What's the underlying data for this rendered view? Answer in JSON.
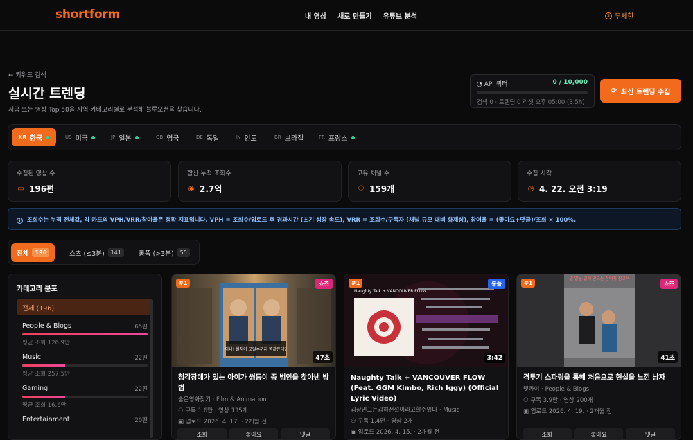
{
  "header": {
    "logo": "shortform",
    "nav": [
      "내 영상",
      "새로 만들기",
      "유튜브 분석"
    ],
    "plan": "무제한"
  },
  "page": {
    "back_link": "← 키워드 검색",
    "title": "실시간 트렌딩",
    "subtitle": "지금 뜨는 영상 Top 50을 지역·카테고리별로 분석해 블루오션을 찾습니다."
  },
  "quota": {
    "label": "API 쿼터",
    "value": "0 / 10,000",
    "meta": "검색 0 · 트렌딩 0 리셋 오후 05:00 (3.5h)",
    "progress": 0
  },
  "refresh_button": "최신 트렌딩 수집",
  "regions": [
    {
      "code": "KR",
      "name": "한국",
      "dot": true,
      "active": true
    },
    {
      "code": "US",
      "name": "미국",
      "dot": true,
      "active": false
    },
    {
      "code": "JP",
      "name": "일본",
      "dot": true,
      "active": false
    },
    {
      "code": "GB",
      "name": "영국",
      "dot": false,
      "active": false
    },
    {
      "code": "DE",
      "name": "독일",
      "dot": false,
      "active": false
    },
    {
      "code": "IN",
      "name": "인도",
      "dot": false,
      "active": false
    },
    {
      "code": "BR",
      "name": "브라질",
      "dot": false,
      "active": false
    },
    {
      "code": "FR",
      "name": "프랑스",
      "dot": true,
      "active": false
    }
  ],
  "stats": [
    {
      "label": "수집된 영상 수",
      "value": "196편",
      "icon": "video-icon"
    },
    {
      "label": "합산 누적 조회수",
      "value": "2.7억",
      "icon": "eye-icon"
    },
    {
      "label": "고유 채널 수",
      "value": "159개",
      "icon": "users-icon"
    },
    {
      "label": "수집 시각",
      "value": "4. 22. 오전 3:19",
      "icon": "clock-icon"
    }
  ],
  "info_note": "조회수는 누적 전체값, 각 카드의 VPH/VRR/참여율은 정확 지표입니다. VPH = 조회수/업로드 후 경과시간 (초기 성장 속도), VRR = 조회수/구독자 (채널 규모 대비 화제성), 참여율 = (좋아요+댓글)/조회 × 100%.",
  "filter_tabs": [
    {
      "label": "전체",
      "count": "196",
      "active": true
    },
    {
      "label": "쇼츠 (≤3분)",
      "count": "141",
      "active": false
    },
    {
      "label": "롱폼 (>3분)",
      "count": "55",
      "active": false
    }
  ],
  "categories": {
    "heading": "카테고리 분포",
    "all_label": "전체 (196)",
    "items": [
      {
        "name": "People & Blogs",
        "count": "65편",
        "avg": "평균 조회 126.9만",
        "share": 1.0
      },
      {
        "name": "Music",
        "count": "22편",
        "avg": "평균 조회 257.5만",
        "share": 0.34
      },
      {
        "name": "Gaming",
        "count": "22편",
        "avg": "평균 조회 16.6만",
        "share": 0.34
      },
      {
        "name": "Entertainment",
        "count": "20편",
        "avg": "",
        "share": 0.31
      }
    ]
  },
  "cards": [
    {
      "rank": "#1",
      "type": "쇼츠",
      "type_color": "#db2777",
      "duration": "47초",
      "title": "청각장애가 있는 아이가 썽둥이 중 범인을 찾아낸 방법",
      "channel": "숨은영화찾기 · Film & Animation",
      "subs": "⚇ 구독 1.6만 · 영상 135개",
      "upload": "▣ 업로드 2026. 4. 17. · 2개월 전",
      "buttons": [
        "조회",
        "좋아요",
        "댓글"
      ],
      "thumb_text": "아니! 실지어 모일수까지 똑같은데?"
    },
    {
      "rank": "#1",
      "type": "롱폼",
      "type_color": "#2563eb",
      "duration": "3:42",
      "title": "Naughty Talk + VANCOUVER FLOW (Feat. GGM Kimbo, Rich Iggy) (Official Lyric Video)",
      "channel": "김상민그는감히전설이라고할수있다 · Music",
      "subs": "⚇ 구독 1.4만 · 영상 2개",
      "upload": "▣ 업로드 2026. 4. 15. · 2개월 전",
      "buttons": [],
      "thumb_text": "Naughty Talk + VANCOUVER FLOW"
    },
    {
      "rank": "#1",
      "type": "쇼츠",
      "type_color": "#db2777",
      "duration": "41초",
      "title": "격투기 스파링을 통해 처음으로 현실을 느낀 남자",
      "channel": "탯카이 · People & Blogs",
      "subs": "⚇ 구독 3.9만 · 영상 200개",
      "upload": "▣ 업로드 2026. 4. 19. · 2개월 전",
      "buttons": [
        "조회",
        "좋아요",
        "댓글"
      ],
      "thumb_text": "말 말을 읽게 만드는 참의지 참교육"
    }
  ]
}
